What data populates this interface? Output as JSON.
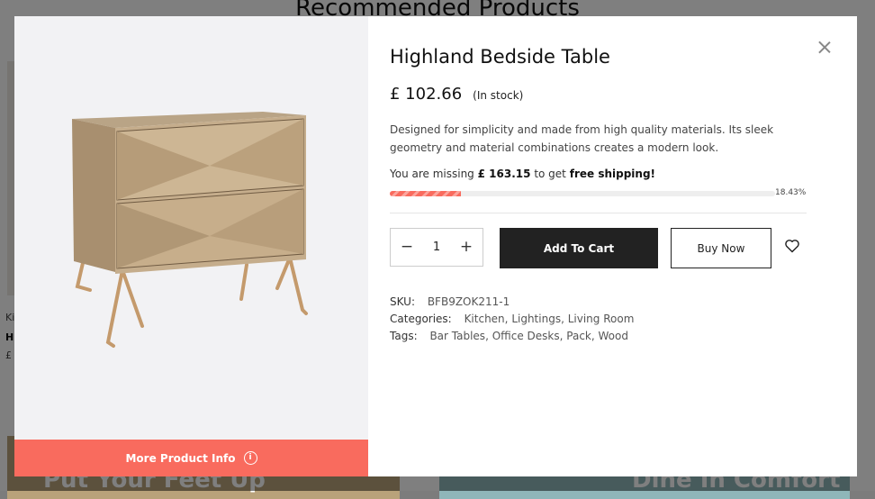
{
  "background": {
    "heading": "Recommended Products",
    "card_meta": [
      "Ki",
      "H",
      "£"
    ],
    "banner_left_text": "Put Your Feet Up",
    "banner_right_text": "Dine In Comfort"
  },
  "modal": {
    "title": "Highland Bedside Table",
    "price": "£ 102.66",
    "stock": "(In stock)",
    "description": "Designed for simplicity and made from high quality materials. Its sleek geometry and material combinations creates a modern look.",
    "shipping": {
      "prefix": "You are missing",
      "amount": "£ 163.15",
      "middle": "to get",
      "highlight": "free shipping!",
      "progress_percent": 18.43,
      "progress_label": "18.43%"
    },
    "quantity": "1",
    "add_to_cart_label": "Add To Cart",
    "buy_now_label": "Buy Now",
    "more_info_label": "More Product Info",
    "sku": {
      "label": "SKU:",
      "value": "BFB9ZOK211-1"
    },
    "categories": {
      "label": "Categories:",
      "values": [
        "Kitchen",
        "Lightings",
        "Living Room"
      ]
    },
    "tags": {
      "label": "Tags:",
      "values": [
        "Bar Tables",
        "Office Desks",
        "Pack",
        "Wood"
      ]
    },
    "icons": {
      "close": "close-icon",
      "wishlist": "heart-icon",
      "info": "info-icon",
      "minus": "minus-icon",
      "plus": "plus-icon"
    },
    "colors": {
      "accent": "#f96b5e",
      "dark": "#222222"
    }
  }
}
